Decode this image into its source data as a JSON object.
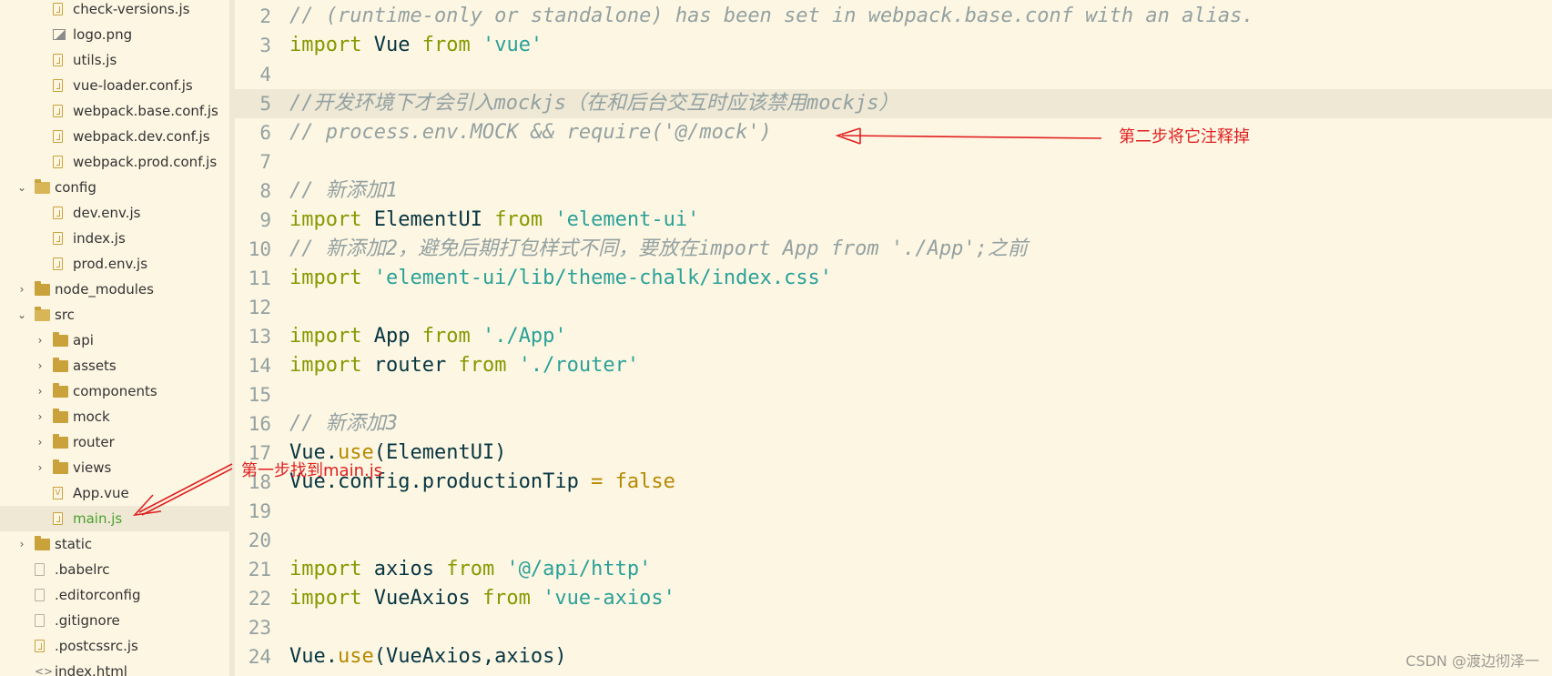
{
  "sidebar": {
    "items": [
      {
        "label": "check-versions.js",
        "icon": "js-file-icon",
        "kind": "file-js",
        "depth": 2
      },
      {
        "label": "logo.png",
        "icon": "image-file-icon",
        "kind": "file-img",
        "depth": 2
      },
      {
        "label": "utils.js",
        "icon": "js-file-icon",
        "kind": "file-js",
        "depth": 2
      },
      {
        "label": "vue-loader.conf.js",
        "icon": "js-file-icon",
        "kind": "file-js",
        "depth": 2
      },
      {
        "label": "webpack.base.conf.js",
        "icon": "js-file-icon",
        "kind": "file-js",
        "depth": 2
      },
      {
        "label": "webpack.dev.conf.js",
        "icon": "js-file-icon",
        "kind": "file-js",
        "depth": 2
      },
      {
        "label": "webpack.prod.conf.js",
        "icon": "js-file-icon",
        "kind": "file-js",
        "depth": 2
      },
      {
        "label": "config",
        "icon": "folder-open-icon",
        "kind": "folder-open",
        "depth": 1
      },
      {
        "label": "dev.env.js",
        "icon": "js-file-icon",
        "kind": "file-js",
        "depth": 2
      },
      {
        "label": "index.js",
        "icon": "js-file-icon",
        "kind": "file-js",
        "depth": 2
      },
      {
        "label": "prod.env.js",
        "icon": "js-file-icon",
        "kind": "file-js",
        "depth": 2
      },
      {
        "label": "node_modules",
        "icon": "folder-icon",
        "kind": "folder-closed",
        "depth": 1
      },
      {
        "label": "src",
        "icon": "folder-open-icon",
        "kind": "folder-open",
        "depth": 1
      },
      {
        "label": "api",
        "icon": "folder-icon",
        "kind": "folder-closed",
        "depth": 2
      },
      {
        "label": "assets",
        "icon": "folder-icon",
        "kind": "folder-closed",
        "depth": 2
      },
      {
        "label": "components",
        "icon": "folder-icon",
        "kind": "folder-closed",
        "depth": 2
      },
      {
        "label": "mock",
        "icon": "folder-icon",
        "kind": "folder-closed",
        "depth": 2
      },
      {
        "label": "router",
        "icon": "folder-icon",
        "kind": "folder-closed",
        "depth": 2
      },
      {
        "label": "views",
        "icon": "folder-icon",
        "kind": "folder-closed",
        "depth": 2
      },
      {
        "label": "App.vue",
        "icon": "vue-file-icon",
        "kind": "file-vue",
        "depth": 2
      },
      {
        "label": "main.js",
        "icon": "js-file-icon",
        "kind": "file-js",
        "depth": 2,
        "selected": true
      },
      {
        "label": "static",
        "icon": "folder-icon",
        "kind": "folder-closed",
        "depth": 1
      },
      {
        "label": ".babelrc",
        "icon": "file-icon",
        "kind": "file-plain",
        "depth": 1
      },
      {
        "label": ".editorconfig",
        "icon": "file-icon",
        "kind": "file-plain",
        "depth": 1
      },
      {
        "label": ".gitignore",
        "icon": "file-icon",
        "kind": "file-plain",
        "depth": 1
      },
      {
        "label": ".postcssrc.js",
        "icon": "js-file-icon",
        "kind": "file-js",
        "depth": 1
      },
      {
        "label": "index.html",
        "icon": "html-file-icon",
        "kind": "file-html",
        "depth": 1
      }
    ]
  },
  "editor": {
    "lines": [
      {
        "n": "2",
        "tokens": [
          {
            "t": "// (runtime-only or standalone) has been set in webpack.base.conf with an alias.",
            "c": "comment"
          }
        ]
      },
      {
        "n": "3",
        "tokens": [
          {
            "t": "import",
            "c": "kw"
          },
          {
            "t": " Vue ",
            "c": ""
          },
          {
            "t": "from",
            "c": "kw"
          },
          {
            "t": " ",
            "c": ""
          },
          {
            "t": "'vue'",
            "c": "str"
          }
        ]
      },
      {
        "n": "4",
        "tokens": []
      },
      {
        "n": "5",
        "highlight": true,
        "tokens": [
          {
            "t": "//开发环境下才会引入mockjs（在和后台交互时应该禁用mockjs）",
            "c": "comment"
          }
        ]
      },
      {
        "n": "6",
        "tokens": [
          {
            "t": "// process.env.MOCK && require('@/mock')",
            "c": "comment"
          }
        ]
      },
      {
        "n": "7",
        "tokens": []
      },
      {
        "n": "8",
        "tokens": [
          {
            "t": "// 新添加1",
            "c": "comment"
          }
        ]
      },
      {
        "n": "9",
        "tokens": [
          {
            "t": "import",
            "c": "kw"
          },
          {
            "t": " ElementUI ",
            "c": ""
          },
          {
            "t": "from",
            "c": "kw"
          },
          {
            "t": " ",
            "c": ""
          },
          {
            "t": "'element-ui'",
            "c": "str"
          }
        ]
      },
      {
        "n": "10",
        "tokens": [
          {
            "t": "// 新添加2，避免后期打包样式不同，要放在import App from './App';之前",
            "c": "comment"
          }
        ]
      },
      {
        "n": "11",
        "tokens": [
          {
            "t": "import",
            "c": "kw"
          },
          {
            "t": " ",
            "c": ""
          },
          {
            "t": "'element-ui/lib/theme-chalk/index.css'",
            "c": "str"
          }
        ]
      },
      {
        "n": "12",
        "tokens": []
      },
      {
        "n": "13",
        "tokens": [
          {
            "t": "import",
            "c": "kw"
          },
          {
            "t": " App ",
            "c": ""
          },
          {
            "t": "from",
            "c": "kw"
          },
          {
            "t": " ",
            "c": ""
          },
          {
            "t": "'./App'",
            "c": "str"
          }
        ]
      },
      {
        "n": "14",
        "tokens": [
          {
            "t": "import",
            "c": "kw"
          },
          {
            "t": " router ",
            "c": ""
          },
          {
            "t": "from",
            "c": "kw"
          },
          {
            "t": " ",
            "c": ""
          },
          {
            "t": "'./router'",
            "c": "str"
          }
        ]
      },
      {
        "n": "15",
        "tokens": []
      },
      {
        "n": "16",
        "tokens": [
          {
            "t": "// 新添加3",
            "c": "comment"
          }
        ]
      },
      {
        "n": "17",
        "tokens": [
          {
            "t": "Vue.",
            "c": ""
          },
          {
            "t": "use",
            "c": "fn"
          },
          {
            "t": "(ElementUI)",
            "c": ""
          }
        ]
      },
      {
        "n": "18",
        "tokens": [
          {
            "t": "Vue.config.productionTip ",
            "c": ""
          },
          {
            "t": "=",
            "c": "fn"
          },
          {
            "t": " ",
            "c": ""
          },
          {
            "t": "false",
            "c": "bool"
          }
        ]
      },
      {
        "n": "19",
        "tokens": []
      },
      {
        "n": "20",
        "tokens": []
      },
      {
        "n": "21",
        "tokens": [
          {
            "t": "import",
            "c": "kw"
          },
          {
            "t": " axios ",
            "c": ""
          },
          {
            "t": "from",
            "c": "kw"
          },
          {
            "t": " ",
            "c": ""
          },
          {
            "t": "'@/api/http'",
            "c": "str"
          }
        ]
      },
      {
        "n": "22",
        "tokens": [
          {
            "t": "import",
            "c": "kw"
          },
          {
            "t": " VueAxios ",
            "c": ""
          },
          {
            "t": "from",
            "c": "kw"
          },
          {
            "t": " ",
            "c": ""
          },
          {
            "t": "'vue-axios'",
            "c": "str"
          }
        ]
      },
      {
        "n": "23",
        "tokens": []
      },
      {
        "n": "24",
        "tokens": [
          {
            "t": "Vue.",
            "c": ""
          },
          {
            "t": "use",
            "c": "fn"
          },
          {
            "t": "(VueAxios,axios)",
            "c": ""
          }
        ]
      }
    ]
  },
  "annotations": {
    "step1": "第一步找到main.js",
    "step2": "第二步将它注释掉",
    "color": "#e02020"
  },
  "watermark": "CSDN @渡边彻泽一",
  "colors": {
    "background": "#fdf6e3",
    "highlight": "#eee8d5",
    "keyword": "#859900",
    "string": "#2aa198",
    "comment": "#93a1a1",
    "selected_file": "#4aa02c"
  }
}
